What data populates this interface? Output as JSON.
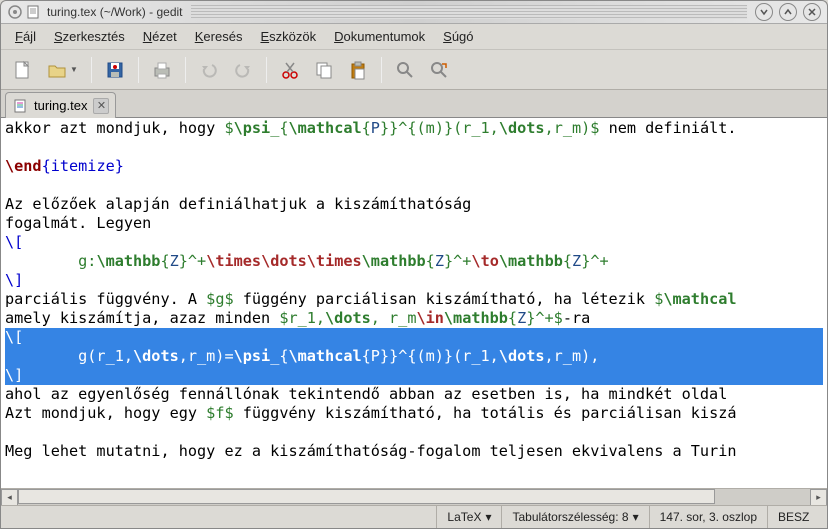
{
  "window": {
    "title": "turing.tex (~/Work) - gedit"
  },
  "menus": [
    "Fájl",
    "Szerkesztés",
    "Nézet",
    "Keresés",
    "Eszközök",
    "Dokumentumok",
    "Súgó"
  ],
  "tab": {
    "label": "turing.tex"
  },
  "status": {
    "filetype": "LaTeX",
    "tabwidth": "Tabulátorszélesség: 8",
    "position": "147. sor, 3. oszlop",
    "ins": "BESZ"
  },
  "editor_lines": [
    {
      "sel": false,
      "segs": [
        {
          "t": "akkor azt mondjuk, hogy ",
          "c": ""
        },
        {
          "t": "$",
          "c": "m"
        },
        {
          "t": "\\psi",
          "c": "gr"
        },
        {
          "t": "_{",
          "c": "m"
        },
        {
          "t": "\\mathcal",
          "c": "gr"
        },
        {
          "t": "{",
          "c": "m"
        },
        {
          "t": "P",
          "c": "compbl"
        },
        {
          "t": "}}^{(m)}(r_1,",
          "c": "m"
        },
        {
          "t": "\\dots",
          "c": "gr"
        },
        {
          "t": ",r_m)$",
          "c": "m"
        },
        {
          "t": " nem definiált.",
          "c": ""
        }
      ]
    },
    {
      "sel": false,
      "segs": []
    },
    {
      "sel": false,
      "segs": [
        {
          "t": "\\end",
          "c": "cmd"
        },
        {
          "t": "{itemize}",
          "c": "bl"
        }
      ]
    },
    {
      "sel": false,
      "segs": []
    },
    {
      "sel": false,
      "segs": [
        {
          "t": "Az előzőek alapján definiálhatjuk a kiszámíthatóság",
          "c": ""
        }
      ]
    },
    {
      "sel": false,
      "segs": [
        {
          "t": "fogalmát. Legyen",
          "c": ""
        }
      ]
    },
    {
      "sel": false,
      "segs": [
        {
          "t": "\\[",
          "c": "bl"
        }
      ]
    },
    {
      "sel": false,
      "segs": [
        {
          "t": "        g:",
          "c": "m"
        },
        {
          "t": "\\mathbb",
          "c": "gr"
        },
        {
          "t": "{",
          "c": "m"
        },
        {
          "t": "Z",
          "c": "compbl"
        },
        {
          "t": "}^+",
          "c": "m"
        },
        {
          "t": "\\times\\dots\\times",
          "c": "kw"
        },
        {
          "t": "\\mathbb",
          "c": "gr"
        },
        {
          "t": "{",
          "c": "m"
        },
        {
          "t": "Z",
          "c": "compbl"
        },
        {
          "t": "}^+",
          "c": "m"
        },
        {
          "t": "\\to",
          "c": "kw"
        },
        {
          "t": "\\mathbb",
          "c": "gr"
        },
        {
          "t": "{",
          "c": "m"
        },
        {
          "t": "Z",
          "c": "compbl"
        },
        {
          "t": "}^+",
          "c": "m"
        }
      ]
    },
    {
      "sel": false,
      "segs": [
        {
          "t": "\\]",
          "c": "bl"
        }
      ]
    },
    {
      "sel": false,
      "segs": [
        {
          "t": "parciális függvény. A ",
          "c": ""
        },
        {
          "t": "$g$",
          "c": "m"
        },
        {
          "t": " függény parciálisan kiszámítható, ha létezik ",
          "c": ""
        },
        {
          "t": "$",
          "c": "m"
        },
        {
          "t": "\\mathcal",
          "c": "gr"
        }
      ]
    },
    {
      "sel": false,
      "segs": [
        {
          "t": "amely kiszámítja, azaz minden ",
          "c": ""
        },
        {
          "t": "$r_1,",
          "c": "m"
        },
        {
          "t": "\\dots",
          "c": "gr"
        },
        {
          "t": ", r_m",
          "c": "m"
        },
        {
          "t": "\\in",
          "c": "kw"
        },
        {
          "t": "\\mathbb",
          "c": "gr"
        },
        {
          "t": "{",
          "c": "m"
        },
        {
          "t": "Z",
          "c": "compbl"
        },
        {
          "t": "}^+$",
          "c": "m"
        },
        {
          "t": "-ra",
          "c": ""
        }
      ]
    },
    {
      "sel": true,
      "segs": [
        {
          "t": "\\[",
          "c": ""
        }
      ]
    },
    {
      "sel": true,
      "segs": [
        {
          "t": "        g(r_1,",
          "c": ""
        },
        {
          "t": "\\dots",
          "c": "bold"
        },
        {
          "t": ",r_m)=",
          "c": ""
        },
        {
          "t": "\\psi",
          "c": "bold"
        },
        {
          "t": "_{",
          "c": ""
        },
        {
          "t": "\\mathcal",
          "c": "bold"
        },
        {
          "t": "{P}}^{(m)}(r_1,",
          "c": ""
        },
        {
          "t": "\\dots",
          "c": "bold"
        },
        {
          "t": ",r_m),",
          "c": ""
        }
      ]
    },
    {
      "sel": true,
      "segs": [
        {
          "t": "\\]",
          "c": ""
        }
      ]
    },
    {
      "sel": false,
      "segs": [
        {
          "t": "ahol az egyenlőség fennállónak tekintendő abban az esetben is, ha mindkét oldal ",
          "c": ""
        }
      ]
    },
    {
      "sel": false,
      "segs": [
        {
          "t": "Azt mondjuk, hogy egy ",
          "c": ""
        },
        {
          "t": "$f$",
          "c": "m"
        },
        {
          "t": " függvény kiszámítható, ha totális és parciálisan kiszá",
          "c": ""
        }
      ]
    },
    {
      "sel": false,
      "segs": []
    },
    {
      "sel": false,
      "segs": [
        {
          "t": "Meg lehet mutatni, hogy ez a kiszámíthatóság-fogalom teljesen ekvivalens a Turin",
          "c": ""
        }
      ]
    }
  ]
}
